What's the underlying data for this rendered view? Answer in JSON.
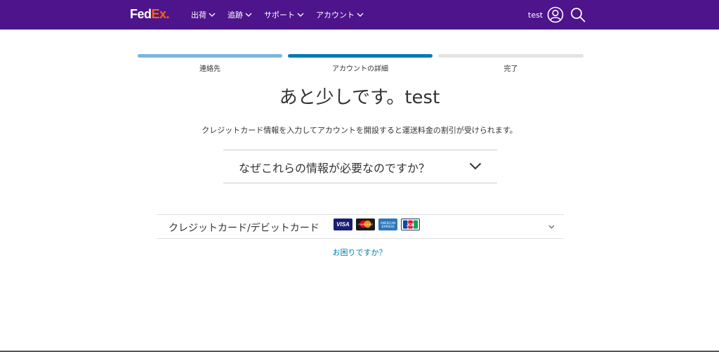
{
  "header": {
    "logo_fed": "Fed",
    "logo_ex": "Ex.",
    "nav": [
      {
        "label": "出荷"
      },
      {
        "label": "追跡"
      },
      {
        "label": "サポート"
      },
      {
        "label": "アカウント"
      }
    ],
    "user_name": "test"
  },
  "progress": {
    "steps": [
      {
        "label": "連絡先",
        "state": "complete"
      },
      {
        "label": "アカウントの詳細",
        "state": "current"
      },
      {
        "label": "完了",
        "state": "pending"
      }
    ]
  },
  "main": {
    "title": "あと少しです。test",
    "subtitle": "クレジットカード情報を入力してアカウントを開設すると運送料金の割引が受けられます。",
    "why_label": "なぜこれらの情報が必要なのですか？",
    "card_label": "クレジットカード/デビットカード",
    "card_logos": [
      "VISA",
      "mastercard",
      "AMERICAN EXPRESS",
      "JCB"
    ],
    "help_link": "お困りですか？"
  },
  "colors": {
    "brand_purple": "#4d148c",
    "brand_orange": "#ff6200",
    "link_blue": "#007ab7",
    "step_done": "#7ab6dc",
    "step_current": "#007ab7",
    "step_pending": "#e3e3e3"
  }
}
